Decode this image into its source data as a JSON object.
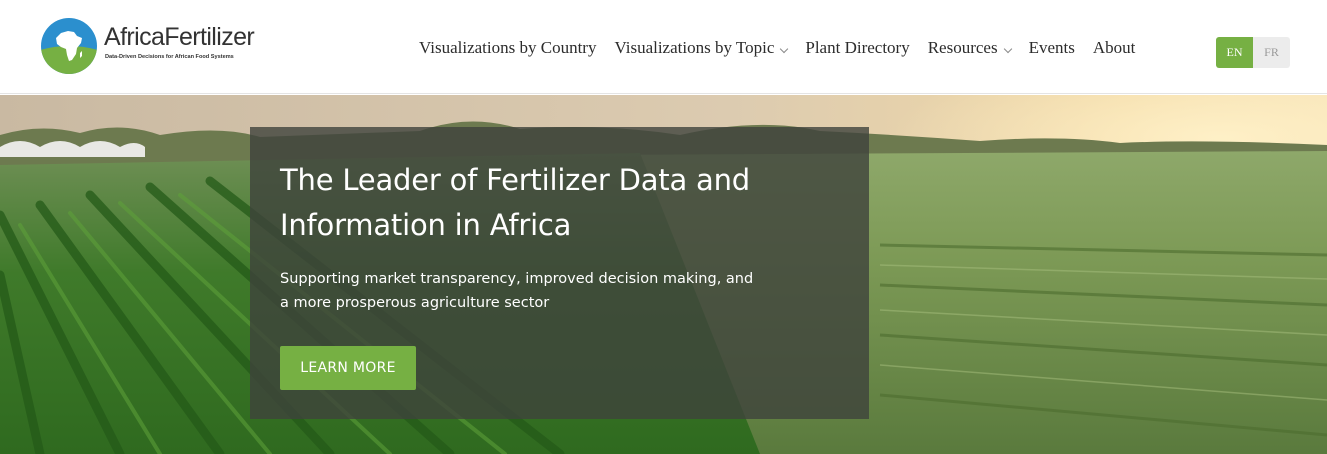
{
  "brand": {
    "name": "AfricaFertilizer",
    "tagline": "Data-Driven Decisions for African Food Systems",
    "logo_icon": "africa-globe-logo",
    "colors": {
      "green": "#76b043",
      "blue": "#2b8fce"
    }
  },
  "nav": {
    "items": [
      {
        "label": "Visualizations by Country",
        "has_dropdown": false
      },
      {
        "label": "Visualizations by Topic",
        "has_dropdown": true
      },
      {
        "label": "Plant Directory",
        "has_dropdown": false
      },
      {
        "label": "Resources",
        "has_dropdown": true
      },
      {
        "label": "Events",
        "has_dropdown": false
      },
      {
        "label": "About",
        "has_dropdown": false
      }
    ]
  },
  "language": {
    "en": "EN",
    "fr": "FR",
    "selected": "EN"
  },
  "hero": {
    "title": "The Leader of Fertilizer Data and Information in Africa",
    "subtitle": "Supporting market transparency, improved decision making, and a more prosperous agriculture sector",
    "button": "LEARN MORE"
  }
}
